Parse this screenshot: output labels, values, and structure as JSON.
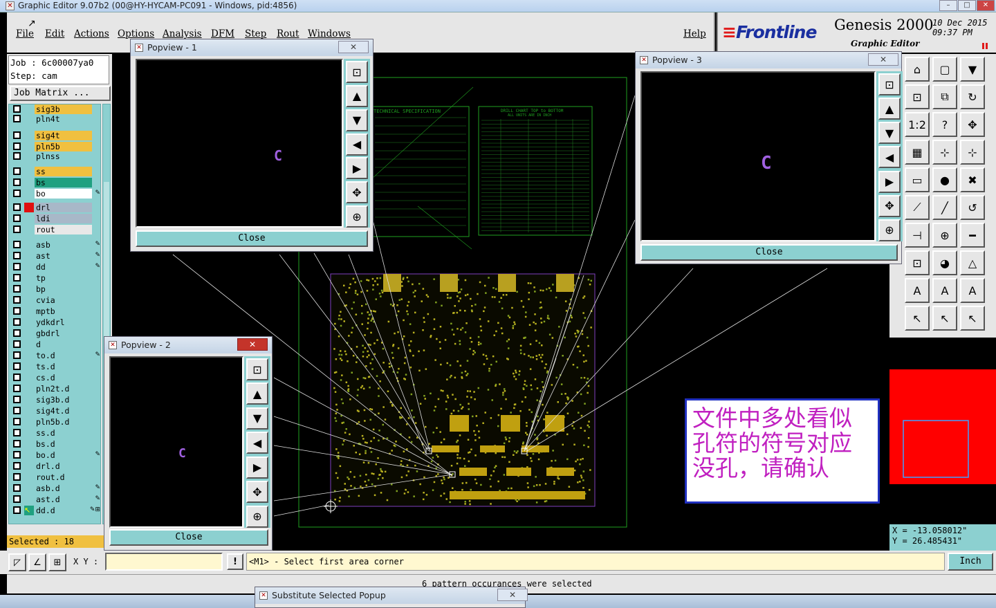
{
  "window": {
    "title": "Graphic Editor 9.07b2 (00@HY-HYCAM-PC091 - Windows, pid:4856)",
    "min": "–",
    "max": "□",
    "close": "✕"
  },
  "menu": [
    "File",
    "Edit",
    "Actions",
    "Options",
    "Analysis",
    "DFM",
    "Step",
    "Rout",
    "Windows"
  ],
  "help": "Help",
  "brand": {
    "logo": "Frontline",
    "title": "Genesis 2000",
    "subtitle": "Graphic Editor",
    "date": "10 Dec 2015",
    "time": "09:37 PM"
  },
  "job": {
    "job": "Job  : 6c00007ya0",
    "step": "Step: cam",
    "matrix_button": "Job Matrix ..."
  },
  "layers": [
    {
      "name": "sig3b",
      "color": "#f0c040",
      "mark": ""
    },
    {
      "name": "pln4t",
      "color": "#8cd0d0",
      "mark": ""
    },
    {
      "name": "sig4t",
      "color": "#f0c040",
      "mark": ""
    },
    {
      "name": "pln5b",
      "color": "#f0c040",
      "mark": ""
    },
    {
      "name": "plnss",
      "color": "#8cd0d0",
      "mark": ""
    },
    {
      "name": "ss",
      "color": "#f0c040",
      "mark": ""
    },
    {
      "name": "bs",
      "color": "#20a080",
      "mark": ""
    },
    {
      "name": "bo",
      "color": "#ffffff",
      "mark": "✎"
    },
    {
      "name": "drl",
      "color": "#a8b8c8",
      "mark": "",
      "swatch": "#e01010"
    },
    {
      "name": "ldi",
      "color": "#a8b8c8",
      "mark": ""
    },
    {
      "name": "rout",
      "color": "#e8e8e8",
      "mark": ""
    },
    {
      "name": "asb",
      "color": "#8cd0d0",
      "mark": "✎"
    },
    {
      "name": "ast",
      "color": "#8cd0d0",
      "mark": "✎"
    },
    {
      "name": "dd",
      "color": "#8cd0d0",
      "mark": "✎"
    },
    {
      "name": "tp",
      "color": "#8cd0d0",
      "mark": ""
    },
    {
      "name": "bp",
      "color": "#8cd0d0",
      "mark": ""
    },
    {
      "name": "cvia",
      "color": "#8cd0d0",
      "mark": ""
    },
    {
      "name": "mptb",
      "color": "#8cd0d0",
      "mark": ""
    },
    {
      "name": "ydkdrl",
      "color": "#8cd0d0",
      "mark": ""
    },
    {
      "name": "gbdrl",
      "color": "#8cd0d0",
      "mark": ""
    },
    {
      "name": "d",
      "color": "#8cd0d0",
      "mark": ""
    },
    {
      "name": "to.d",
      "color": "#8cd0d0",
      "mark": "✎"
    },
    {
      "name": "ts.d",
      "color": "#8cd0d0",
      "mark": ""
    },
    {
      "name": "cs.d",
      "color": "#8cd0d0",
      "mark": ""
    },
    {
      "name": "pln2t.d",
      "color": "#8cd0d0",
      "mark": ""
    },
    {
      "name": "sig3b.d",
      "color": "#8cd0d0",
      "mark": ""
    },
    {
      "name": "sig4t.d",
      "color": "#8cd0d0",
      "mark": ""
    },
    {
      "name": "pln5b.d",
      "color": "#8cd0d0",
      "mark": ""
    },
    {
      "name": "ss.d",
      "color": "#8cd0d0",
      "mark": ""
    },
    {
      "name": "bs.d",
      "color": "#8cd0d0",
      "mark": ""
    },
    {
      "name": "bo.d",
      "color": "#8cd0d0",
      "mark": "✎"
    },
    {
      "name": "drl.d",
      "color": "#8cd0d0",
      "mark": ""
    },
    {
      "name": "rout.d",
      "color": "#8cd0d0",
      "mark": ""
    },
    {
      "name": "asb.d",
      "color": "#8cd0d0",
      "mark": "✎"
    },
    {
      "name": "ast.d",
      "color": "#8cd0d0",
      "mark": "✎"
    },
    {
      "name": "dd.d",
      "color": "#8cd0d0",
      "mark": "✎⊞",
      "swatch": "#ffffff",
      "arrow": "↖"
    }
  ],
  "selected": "Selected : 18",
  "popups": [
    {
      "title": "Popview - 1",
      "close": "Close",
      "x": "✕",
      "glyph": "C"
    },
    {
      "title": "Popview - 2",
      "close": "Close",
      "x": "✕",
      "glyph": "C"
    },
    {
      "title": "Popview - 3",
      "close": "Close",
      "x": "✕",
      "glyph": "C"
    }
  ],
  "spec": {
    "heading": "TECHNICAL SPECIFICATION",
    "drill_heading": "DRILL CHART  TOP to BOTTOM",
    "drill_sub": "ALL UNITS ARE IN INCH",
    "drill_cols": [
      "FIGURE",
      "SIZE",
      "TOLERANCE",
      "PLATED",
      "QTY"
    ]
  },
  "note": "文件中多处看似孔符的符号对应没孔，请确认",
  "coords": {
    "x": "X = -13.058012\"",
    "y": "Y = 26.485431\""
  },
  "status": {
    "xy_label": "X Y :",
    "xy_value": "",
    "prompt": "<M1> - Select first area corner",
    "units": "Inch"
  },
  "message": "6 pattern occurances were selected",
  "substitute": {
    "title": "Substitute Selected Popup",
    "x": "✕"
  },
  "colors": {
    "panel": "#e6e6e6",
    "teal": "#8cd0d0",
    "gold": "#f0c040",
    "board": "#b8b020",
    "border": "#208020",
    "glyph": "#a060e0"
  }
}
